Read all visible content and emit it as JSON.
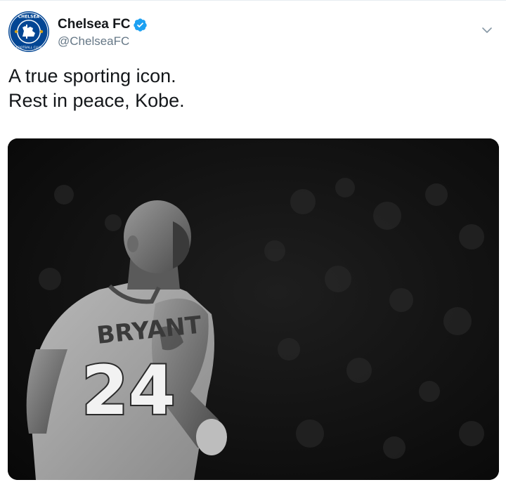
{
  "account": {
    "display_name": "Chelsea FC",
    "handle": "@ChelseaFC",
    "verified": true,
    "avatar_icon": "chelsea-crest-icon"
  },
  "tweet": {
    "lines": [
      "A true sporting icon.",
      "Rest in peace, Kobe."
    ]
  },
  "media": {
    "jersey_name": "BRYANT",
    "jersey_number": "24"
  },
  "colors": {
    "verified_blue": "#1da1f2",
    "chelsea_blue": "#034694",
    "handle_gray": "#657786"
  }
}
